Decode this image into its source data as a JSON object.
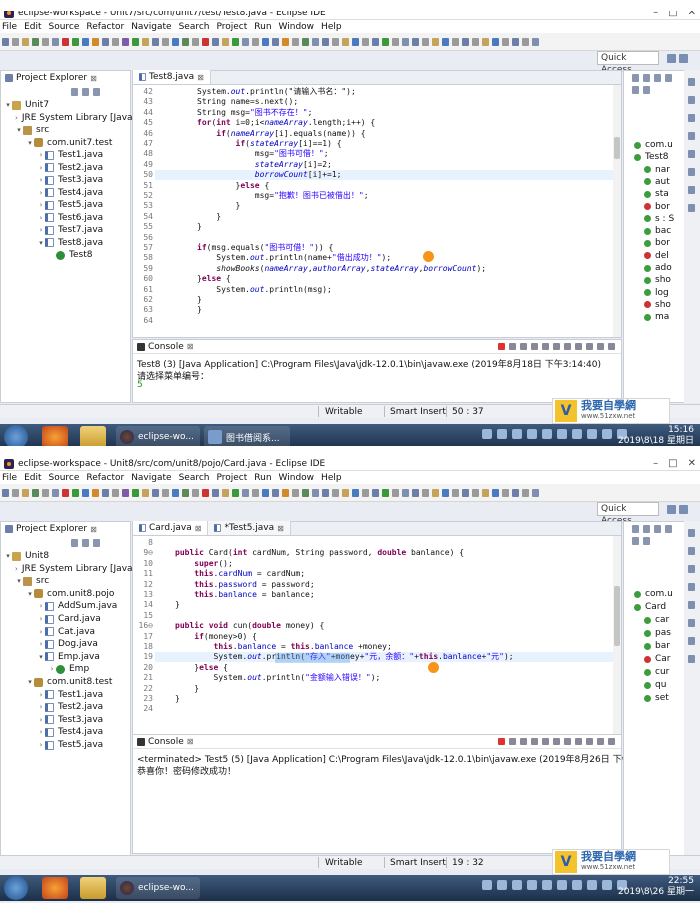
{
  "shot1": {
    "title": "eclipse-workspace - Unit7/src/com/unit7/test/Test8.java - Eclipse IDE",
    "menu": [
      "File",
      "Edit",
      "Source",
      "Refactor",
      "Navigate",
      "Search",
      "Project",
      "Run",
      "Window",
      "Help"
    ],
    "quick_access": "Quick Access",
    "explorer_tab": "Project Explorer",
    "tree": [
      {
        "label": "Unit7",
        "icon": "prj",
        "depth": 0,
        "tw": "▾"
      },
      {
        "label": "JRE System Library [Java",
        "icon": "lib",
        "depth": 1,
        "tw": "›"
      },
      {
        "label": "src",
        "icon": "src",
        "depth": 1,
        "tw": "▾"
      },
      {
        "label": "com.unit7.test",
        "icon": "pkg",
        "depth": 2,
        "tw": "▾"
      },
      {
        "label": "Test1.java",
        "icon": "jv",
        "depth": 3,
        "tw": "›"
      },
      {
        "label": "Test2.java",
        "icon": "jv",
        "depth": 3,
        "tw": "›"
      },
      {
        "label": "Test3.java",
        "icon": "jv",
        "depth": 3,
        "tw": "›"
      },
      {
        "label": "Test4.java",
        "icon": "jv",
        "depth": 3,
        "tw": "›"
      },
      {
        "label": "Test5.java",
        "icon": "jv",
        "depth": 3,
        "tw": "›"
      },
      {
        "label": "Test6.java",
        "icon": "jv",
        "depth": 3,
        "tw": "›"
      },
      {
        "label": "Test7.java",
        "icon": "jv",
        "depth": 3,
        "tw": "›"
      },
      {
        "label": "Test8.java",
        "icon": "jv",
        "depth": 3,
        "tw": "▾"
      },
      {
        "label": "Test8",
        "icon": "cls",
        "depth": 4,
        "tw": ""
      }
    ],
    "editor_tabs": [
      "Test8.java"
    ],
    "line_numbers": [
      "42",
      "43",
      "44",
      "45",
      "46",
      "47",
      "48",
      "49",
      "50",
      "51",
      "52",
      "53",
      "54",
      "55",
      "56",
      "57",
      "58",
      "59",
      "60",
      "61",
      "62",
      "63",
      "64"
    ],
    "console_tab": "Console",
    "console_path": "Test8 (3) [Java Application] C:\\Program Files\\Java\\jdk-12.0.1\\bin\\javaw.exe (2019年8月18日 下午3:14:40)",
    "console_lines": [
      "请选择菜单编号：",
      "5"
    ],
    "outline": [
      "com.u",
      "Test8",
      "nar",
      "aut",
      "sta",
      "bor",
      "s : S",
      "bac",
      "bor",
      "del",
      "ado",
      "sho",
      "log",
      "sho",
      "ma"
    ],
    "status": {
      "mode": "Writable",
      "insert": "Smart Insert",
      "pos": "50 : 37"
    },
    "logo": {
      "name": "我要自學網",
      "url": "www.51zxw.net"
    },
    "taskbar": {
      "task1": "eclipse-wo...",
      "task2": "图书借阅系..."
    },
    "clock": {
      "time": "15:16",
      "date": "2019\\8\\18 星期日"
    }
  },
  "shot2": {
    "title": "eclipse-workspace - Unit8/src/com/unit8/pojo/Card.java - Eclipse IDE",
    "menu": [
      "File",
      "Edit",
      "Source",
      "Refactor",
      "Navigate",
      "Search",
      "Project",
      "Run",
      "Window",
      "Help"
    ],
    "quick_access": "Quick Access",
    "explorer_tab": "Project Explorer",
    "tree": [
      {
        "label": "Unit8",
        "icon": "prj",
        "depth": 0,
        "tw": "▾"
      },
      {
        "label": "JRE System Library [Java",
        "icon": "lib",
        "depth": 1,
        "tw": "›"
      },
      {
        "label": "src",
        "icon": "src",
        "depth": 1,
        "tw": "▾"
      },
      {
        "label": "com.unit8.pojo",
        "icon": "pkg",
        "depth": 2,
        "tw": "▾"
      },
      {
        "label": "AddSum.java",
        "icon": "jv",
        "depth": 3,
        "tw": "›"
      },
      {
        "label": "Card.java",
        "icon": "jv",
        "depth": 3,
        "tw": "›"
      },
      {
        "label": "Cat.java",
        "icon": "jv",
        "depth": 3,
        "tw": "›"
      },
      {
        "label": "Dog.java",
        "icon": "jv",
        "depth": 3,
        "tw": "›"
      },
      {
        "label": "Emp.java",
        "icon": "jv",
        "depth": 3,
        "tw": "▾"
      },
      {
        "label": "Emp",
        "icon": "cls",
        "depth": 4,
        "tw": "›"
      },
      {
        "label": "com.unit8.test",
        "icon": "pkg",
        "depth": 2,
        "tw": "▾"
      },
      {
        "label": "Test1.java",
        "icon": "jv",
        "depth": 3,
        "tw": "›"
      },
      {
        "label": "Test2.java",
        "icon": "jv",
        "depth": 3,
        "tw": "›"
      },
      {
        "label": "Test3.java",
        "icon": "jv",
        "depth": 3,
        "tw": "›"
      },
      {
        "label": "Test4.java",
        "icon": "jv",
        "depth": 3,
        "tw": "›"
      },
      {
        "label": "Test5.java",
        "icon": "jv",
        "depth": 3,
        "tw": "›"
      }
    ],
    "editor_tabs": [
      "Card.java",
      "*Test5.java"
    ],
    "line_numbers": [
      "8",
      "9⊖",
      "10",
      "11",
      "12",
      "13",
      "14",
      "15",
      "16⊖",
      "17",
      "18",
      "19",
      "20",
      "21",
      "22",
      "23",
      "24"
    ],
    "console_tab": "Console",
    "console_path": "<terminated> Test5 (5) [Java Application] C:\\Program Files\\Java\\jdk-12.0.1\\bin\\javaw.exe (2019年8月26日 下午10:53:13)",
    "console_lines": [
      "恭喜你！密码修改成功！"
    ],
    "outline": [
      "com.u",
      "Card",
      "car",
      "pas",
      "bar",
      "Car",
      "cur",
      "qu",
      "set"
    ],
    "status": {
      "mode": "Writable",
      "insert": "Smart Insert",
      "pos": "19 : 32"
    },
    "logo": {
      "name": "我要自學網",
      "url": "www.51zxw.net"
    },
    "taskbar": {
      "task1": "eclipse-wo..."
    },
    "clock": {
      "time": "22:55",
      "date": "2019\\8\\26 星期一"
    }
  },
  "code1": [
    [
      [
        "System.",
        "n"
      ],
      [
        "out",
        "fld it"
      ],
      [
        ".println(\"请输入书名：\");",
        "n"
      ]
    ],
    [
      [
        "String name=s.next();",
        "n"
      ]
    ],
    [
      [
        "String msg=",
        "n"
      ],
      [
        "\"图书不存在！\"",
        "str"
      ],
      [
        ";",
        "n"
      ]
    ],
    [
      [
        "for",
        "kw"
      ],
      [
        "(",
        "n"
      ],
      [
        "int",
        "kw"
      ],
      [
        " i=0;i<",
        "n"
      ],
      [
        "nameArray",
        "fld it"
      ],
      [
        ".length;i++) {",
        "n"
      ]
    ],
    [
      [
        "    ",
        "n"
      ],
      [
        "if",
        "kw"
      ],
      [
        "(",
        "n"
      ],
      [
        "nameArray",
        "fld it"
      ],
      [
        "[i].equals(name)) {",
        "n"
      ]
    ],
    [
      [
        "        ",
        "n"
      ],
      [
        "if",
        "kw"
      ],
      [
        "(",
        "n"
      ],
      [
        "stateArray",
        "fld it"
      ],
      [
        "[i]==1) {",
        "n"
      ]
    ],
    [
      [
        "            msg=",
        "n"
      ],
      [
        "\"图书可借！\"",
        "str"
      ],
      [
        ";",
        "n"
      ]
    ],
    [
      [
        "            ",
        "n"
      ],
      [
        "stateArray",
        "fld it"
      ],
      [
        "[i]=2;",
        "n"
      ]
    ],
    [
      [
        "            ",
        "n"
      ],
      [
        "borrowCount",
        "fld it"
      ],
      [
        "[i]+=1;",
        "n"
      ]
    ],
    [
      [
        "        }",
        "n"
      ],
      [
        "else",
        "kw"
      ],
      [
        " {",
        "n"
      ]
    ],
    [
      [
        "            msg=",
        "n"
      ],
      [
        "\"抱歉！图书已被借出！\"",
        "str"
      ],
      [
        ";",
        "n"
      ]
    ],
    [
      [
        "        }",
        "n"
      ]
    ],
    [
      [
        "    }",
        "n"
      ]
    ],
    [
      [
        "}",
        "n"
      ]
    ],
    [
      [
        "",
        "n"
      ]
    ],
    [
      [
        "if",
        "kw"
      ],
      [
        "(msg.equals(",
        "n"
      ],
      [
        "\"图书可借！\"",
        "str"
      ],
      [
        ")) {",
        "n"
      ]
    ],
    [
      [
        "    System.",
        "n"
      ],
      [
        "out",
        "fld it"
      ],
      [
        ".println(name+",
        "n"
      ],
      [
        "\"借出成功！\"",
        "str"
      ],
      [
        ");",
        "n"
      ]
    ],
    [
      [
        "    ",
        "n"
      ],
      [
        "showBooks",
        "it"
      ],
      [
        "(",
        "n"
      ],
      [
        "nameArray",
        "fld it"
      ],
      [
        ",",
        "n"
      ],
      [
        "authorArray",
        "fld it"
      ],
      [
        ",",
        "n"
      ],
      [
        "stateArray",
        "fld it"
      ],
      [
        ",",
        "n"
      ],
      [
        "borrowCount",
        "fld it"
      ],
      [
        ");",
        "n"
      ]
    ],
    [
      [
        "}",
        "n"
      ],
      [
        "else",
        "kw"
      ],
      [
        " {",
        "n"
      ]
    ],
    [
      [
        "    System.",
        "n"
      ],
      [
        "out",
        "fld it"
      ],
      [
        ".println(msg);",
        "n"
      ]
    ],
    [
      [
        "}",
        "n"
      ]
    ],
    [
      [
        "}",
        "n"
      ]
    ],
    [
      [
        "",
        "n"
      ]
    ]
  ],
  "code2": [
    [
      [
        "",
        "n"
      ]
    ],
    [
      [
        "public",
        "kw"
      ],
      [
        " Card(",
        "n"
      ],
      [
        "int",
        "kw"
      ],
      [
        " cardNum, String password, ",
        "n"
      ],
      [
        "double",
        "kw"
      ],
      [
        " banlance) {",
        "n"
      ]
    ],
    [
      [
        "    ",
        "n"
      ],
      [
        "super",
        "kw"
      ],
      [
        "();",
        "n"
      ]
    ],
    [
      [
        "    ",
        "n"
      ],
      [
        "this",
        "kw"
      ],
      [
        ".",
        "n"
      ],
      [
        "cardNum",
        "fld"
      ],
      [
        " = cardNum;",
        "n"
      ]
    ],
    [
      [
        "    ",
        "n"
      ],
      [
        "this",
        "kw"
      ],
      [
        ".",
        "n"
      ],
      [
        "password",
        "fld"
      ],
      [
        " = password;",
        "n"
      ]
    ],
    [
      [
        "    ",
        "n"
      ],
      [
        "this",
        "kw"
      ],
      [
        ".",
        "n"
      ],
      [
        "banlance",
        "fld"
      ],
      [
        " = banlance;",
        "n"
      ]
    ],
    [
      [
        "}",
        "n"
      ]
    ],
    [
      [
        "",
        "n"
      ]
    ],
    [
      [
        "public",
        "kw"
      ],
      [
        " ",
        "n"
      ],
      [
        "void",
        "kw"
      ],
      [
        " cun(",
        "n"
      ],
      [
        "double",
        "kw"
      ],
      [
        " money) {",
        "n"
      ]
    ],
    [
      [
        "    ",
        "n"
      ],
      [
        "if",
        "kw"
      ],
      [
        "(money>0) {",
        "n"
      ]
    ],
    [
      [
        "        ",
        "n"
      ],
      [
        "this",
        "kw"
      ],
      [
        ".",
        "n"
      ],
      [
        "banlance",
        "fld"
      ],
      [
        " = ",
        "n"
      ],
      [
        "this",
        "kw"
      ],
      [
        ".",
        "n"
      ],
      [
        "banlance",
        "fld"
      ],
      [
        " +money;",
        "n"
      ]
    ],
    [
      [
        "        System.",
        "n"
      ],
      [
        "out",
        "fld it"
      ],
      [
        ".println(",
        "n"
      ],
      [
        "\"存入\"",
        "str"
      ],
      [
        "+money+",
        "n"
      ],
      [
        "\"元，余额：\"",
        "str"
      ],
      [
        "+",
        "n"
      ],
      [
        "this",
        "kw"
      ],
      [
        ".",
        "n"
      ],
      [
        "banlance",
        "fld"
      ],
      [
        "+",
        "n"
      ],
      [
        "\"元\"",
        "str"
      ],
      [
        ");",
        "n"
      ]
    ],
    [
      [
        "    }",
        "n"
      ],
      [
        "else",
        "kw"
      ],
      [
        " {",
        "n"
      ]
    ],
    [
      [
        "        System.",
        "n"
      ],
      [
        "out",
        "fld it"
      ],
      [
        ".println(",
        "n"
      ],
      [
        "\"金额输入错误！\"",
        "str"
      ],
      [
        ");",
        "n"
      ]
    ],
    [
      [
        "    }",
        "n"
      ]
    ],
    [
      [
        "}",
        "n"
      ]
    ],
    [
      [
        "",
        "n"
      ]
    ]
  ]
}
